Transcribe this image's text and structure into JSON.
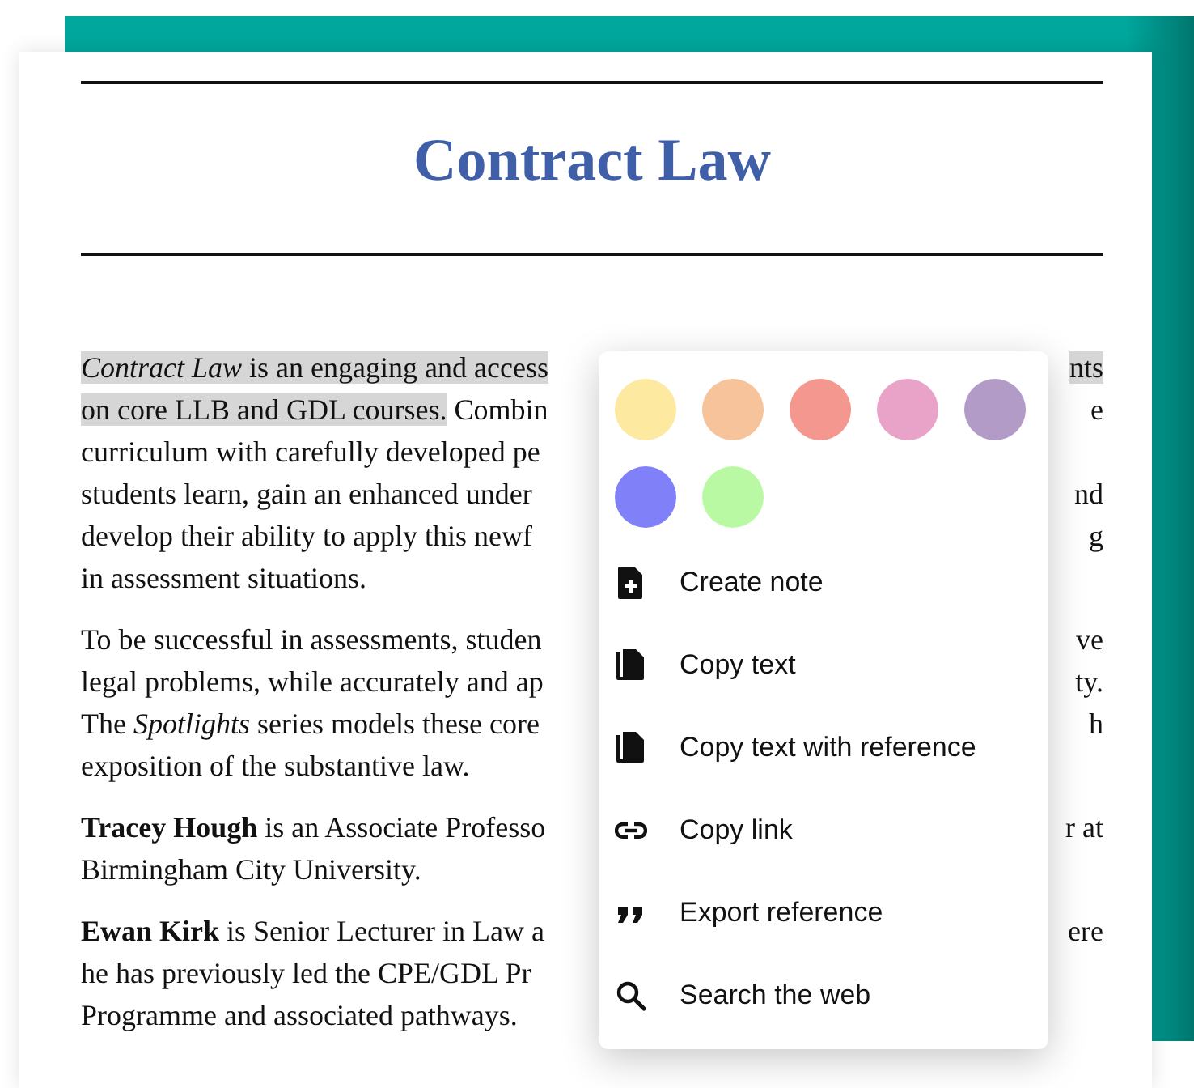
{
  "book": {
    "title": "Contract Law"
  },
  "paragraphs": [
    {
      "lines": [
        {
          "left": [
            {
              "text": "*Contract Law* is an engaging and access",
              "highlighted": true
            }
          ],
          "right": [
            {
              "text": "nts",
              "highlighted": true
            }
          ]
        },
        {
          "left": [
            {
              "text": "on core LLB and GDL courses.",
              "highlighted": true
            },
            {
              "text": " Combin",
              "highlighted": false
            }
          ],
          "right": [
            {
              "text": "e",
              "highlighted": false
            }
          ]
        },
        {
          "left": [
            {
              "text": "curriculum with carefully developed pe",
              "highlighted": false
            }
          ]
        },
        {
          "left": [
            {
              "text": "students learn, gain an enhanced under",
              "highlighted": false
            }
          ],
          "right": [
            {
              "text": "nd",
              "highlighted": false
            }
          ]
        },
        {
          "left": [
            {
              "text": "develop their ability to apply this newf",
              "highlighted": false
            }
          ],
          "right": [
            {
              "text": "g",
              "highlighted": false
            }
          ]
        },
        {
          "left": [
            {
              "text": "in assessment situations.",
              "highlighted": false
            }
          ]
        }
      ]
    },
    {
      "lines": [
        {
          "left": [
            {
              "text": "To be successful in assessments, studen",
              "highlighted": false
            }
          ],
          "right": [
            {
              "text": "ve",
              "highlighted": false
            }
          ]
        },
        {
          "left": [
            {
              "text": "legal problems, while accurately and ap",
              "highlighted": false
            }
          ],
          "right": [
            {
              "text": "ty.",
              "highlighted": false
            }
          ]
        },
        {
          "left": [
            {
              "text": "The *Spotlights* series models these core",
              "highlighted": false
            }
          ],
          "right": [
            {
              "text": "h",
              "highlighted": false
            }
          ]
        },
        {
          "left": [
            {
              "text": "exposition of the substantive law.",
              "highlighted": false
            }
          ]
        }
      ]
    },
    {
      "lines": [
        {
          "left": [
            {
              "text": "**Tracey Hough** is an Associate Professo",
              "highlighted": false
            }
          ],
          "right": [
            {
              "text": "r at",
              "highlighted": false
            }
          ]
        },
        {
          "left": [
            {
              "text": "Birmingham City University.",
              "highlighted": false
            }
          ]
        }
      ]
    },
    {
      "lines": [
        {
          "left": [
            {
              "text": "**Ewan Kirk** is Senior Lecturer in Law a",
              "highlighted": false
            }
          ],
          "right": [
            {
              "text": "ere",
              "highlighted": false
            }
          ]
        },
        {
          "left": [
            {
              "text": "he has previously led the CPE/GDL Pr",
              "highlighted": false
            }
          ]
        },
        {
          "left": [
            {
              "text": "Programme and associated pathways.",
              "highlighted": false
            }
          ]
        }
      ]
    }
  ],
  "menu": {
    "colors": [
      {
        "color": "#fde9a0"
      },
      {
        "color": "#f6c39b"
      },
      {
        "color": "#f4978e"
      },
      {
        "color": "#eaa3c8"
      },
      {
        "color": "#b39bc8"
      },
      {
        "color": "#8080f9"
      },
      {
        "color": "#baf9a4"
      }
    ],
    "items": [
      {
        "label": "Create note",
        "kind": "note"
      },
      {
        "label": "Copy text",
        "kind": "copy"
      },
      {
        "label": "Copy text with reference",
        "kind": "copy"
      },
      {
        "label": "Copy link",
        "kind": "link"
      },
      {
        "label": "Export reference",
        "kind": "quote"
      },
      {
        "label": "Search the web",
        "kind": "search"
      }
    ]
  }
}
